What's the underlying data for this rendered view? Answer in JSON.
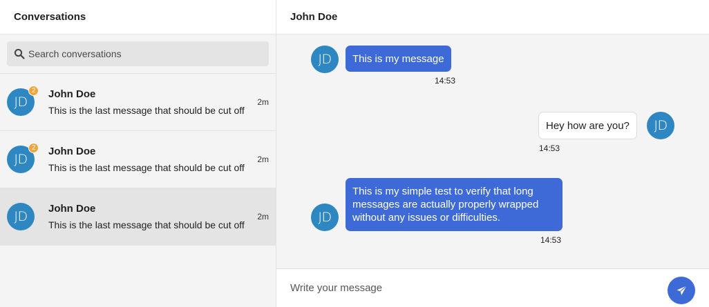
{
  "sidebar": {
    "title": "Conversations",
    "search": {
      "placeholder": "Search conversations",
      "value": ""
    },
    "conversations": [
      {
        "initials": "JD",
        "name": "John Doe",
        "preview": "This is the last message that should be cut off",
        "time": "2m",
        "unread": "2",
        "active": false
      },
      {
        "initials": "JD",
        "name": "John Doe",
        "preview": "This is the last message that should be cut off",
        "time": "2m",
        "unread": "2",
        "active": false
      },
      {
        "initials": "JD",
        "name": "John Doe",
        "preview": "This is the last message that should be cut off",
        "time": "2m",
        "unread": "",
        "active": true
      }
    ]
  },
  "chat": {
    "title": "John Doe",
    "messages": [
      {
        "initials": "JD",
        "text": "This is my message",
        "time": "14:53",
        "mine": true
      },
      {
        "initials": "JD",
        "text": "Hey how are you?",
        "time": "14:53",
        "mine": false
      },
      {
        "initials": "JD",
        "text": "This is my simple test to verify that long messages are actually properly wrapped without any issues or difficulties.",
        "time": "14:53",
        "mine": true
      }
    ],
    "composer": {
      "placeholder": "Write your message",
      "value": ""
    },
    "send_icon": "send-icon"
  },
  "colors": {
    "accent": "#3d6ad6",
    "avatar": "#2f87c1",
    "badge": "#f0a43a"
  }
}
